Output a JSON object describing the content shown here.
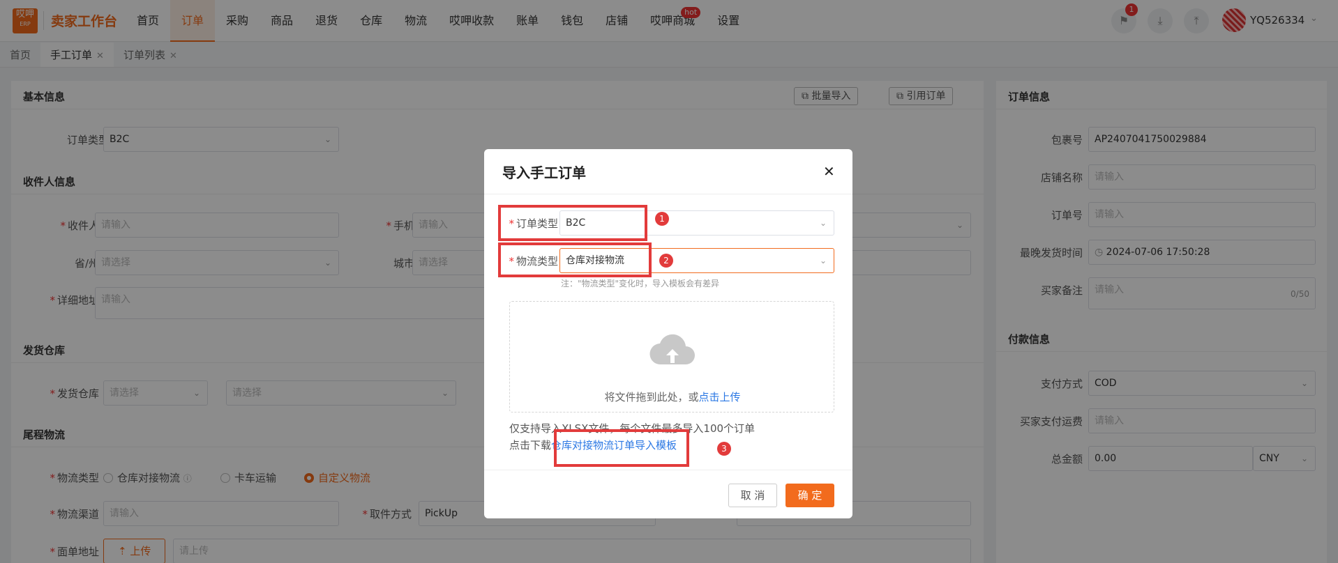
{
  "brand": {
    "logo_text": "哎呷",
    "logo_sub": "ERP",
    "title": "卖家工作台"
  },
  "nav": {
    "items": [
      "首页",
      "订单",
      "采购",
      "商品",
      "退货",
      "仓库",
      "物流",
      "哎呷收款",
      "账单",
      "钱包",
      "店铺",
      "哎呷商城",
      "设置"
    ],
    "hot_label": "hot",
    "notif_count": "1",
    "username": "YQ526334"
  },
  "tabs": {
    "home": "首页",
    "manual": "手工订单",
    "list": "订单列表"
  },
  "left": {
    "basic_title": "基本信息",
    "batch_import": "批量导入",
    "quote_order": "引用订单",
    "order_type_label": "订单类型",
    "order_type_value": "B2C",
    "recipient_title": "收件人信息",
    "recipient_label": "收件人",
    "phone_label": "手机",
    "province_label": "省/州",
    "city_label": "城市",
    "address_label": "详细地址",
    "warehouse_title": "发货仓库",
    "warehouse_label": "发货仓库",
    "last_mile_title": "尾程物流",
    "logistics_type_label": "物流类型",
    "radio_warehouse": "仓库对接物流",
    "radio_truck": "卡车运输",
    "radio_custom": "自定义物流",
    "channel_label": "物流渠道",
    "pickup_label": "取件方式",
    "pickup_value": "PickUp",
    "label_addr_label": "面单地址",
    "upload_btn": "上传",
    "upload_placeholder": "请上传",
    "placeholder_input": "请输入",
    "placeholder_select": "请选择"
  },
  "right": {
    "order_info_title": "订单信息",
    "package_label": "包裹号",
    "package_value": "AP2407041750029884",
    "shop_label": "店铺名称",
    "order_no_label": "订单号",
    "ship_time_label": "最晚发货时间",
    "ship_time_value": "2024-07-06 17:50:28",
    "buyer_note_label": "买家备注",
    "note_counter": "0/50",
    "payment_title": "付款信息",
    "pay_method_label": "支付方式",
    "pay_method_value": "COD",
    "shipping_fee_label": "买家支付运费",
    "total_label": "总金额",
    "total_value": "0.00",
    "currency": "CNY"
  },
  "modal": {
    "title": "导入手工订单",
    "order_type_label": "订单类型",
    "order_type_value": "B2C",
    "logistics_label": "物流类型",
    "logistics_value": "仓库对接物流",
    "note": "注：\"物流类型\"变化时，导入模板会有差异",
    "drop_text": "将文件拖到此处，或",
    "drop_link": "点击上传",
    "support_text": "仅支持导入XLSX文件，每个文件最多导入100个订单",
    "download_prefix": "点击下载",
    "download_link": "仓库对接物流订单导入模板",
    "cancel": "取 消",
    "confirm": "确 定",
    "markers": [
      "1",
      "2",
      "3"
    ]
  },
  "colors": {
    "accent": "#f26b1d",
    "annotation": "#e23b3b",
    "link": "#2b78e4"
  }
}
